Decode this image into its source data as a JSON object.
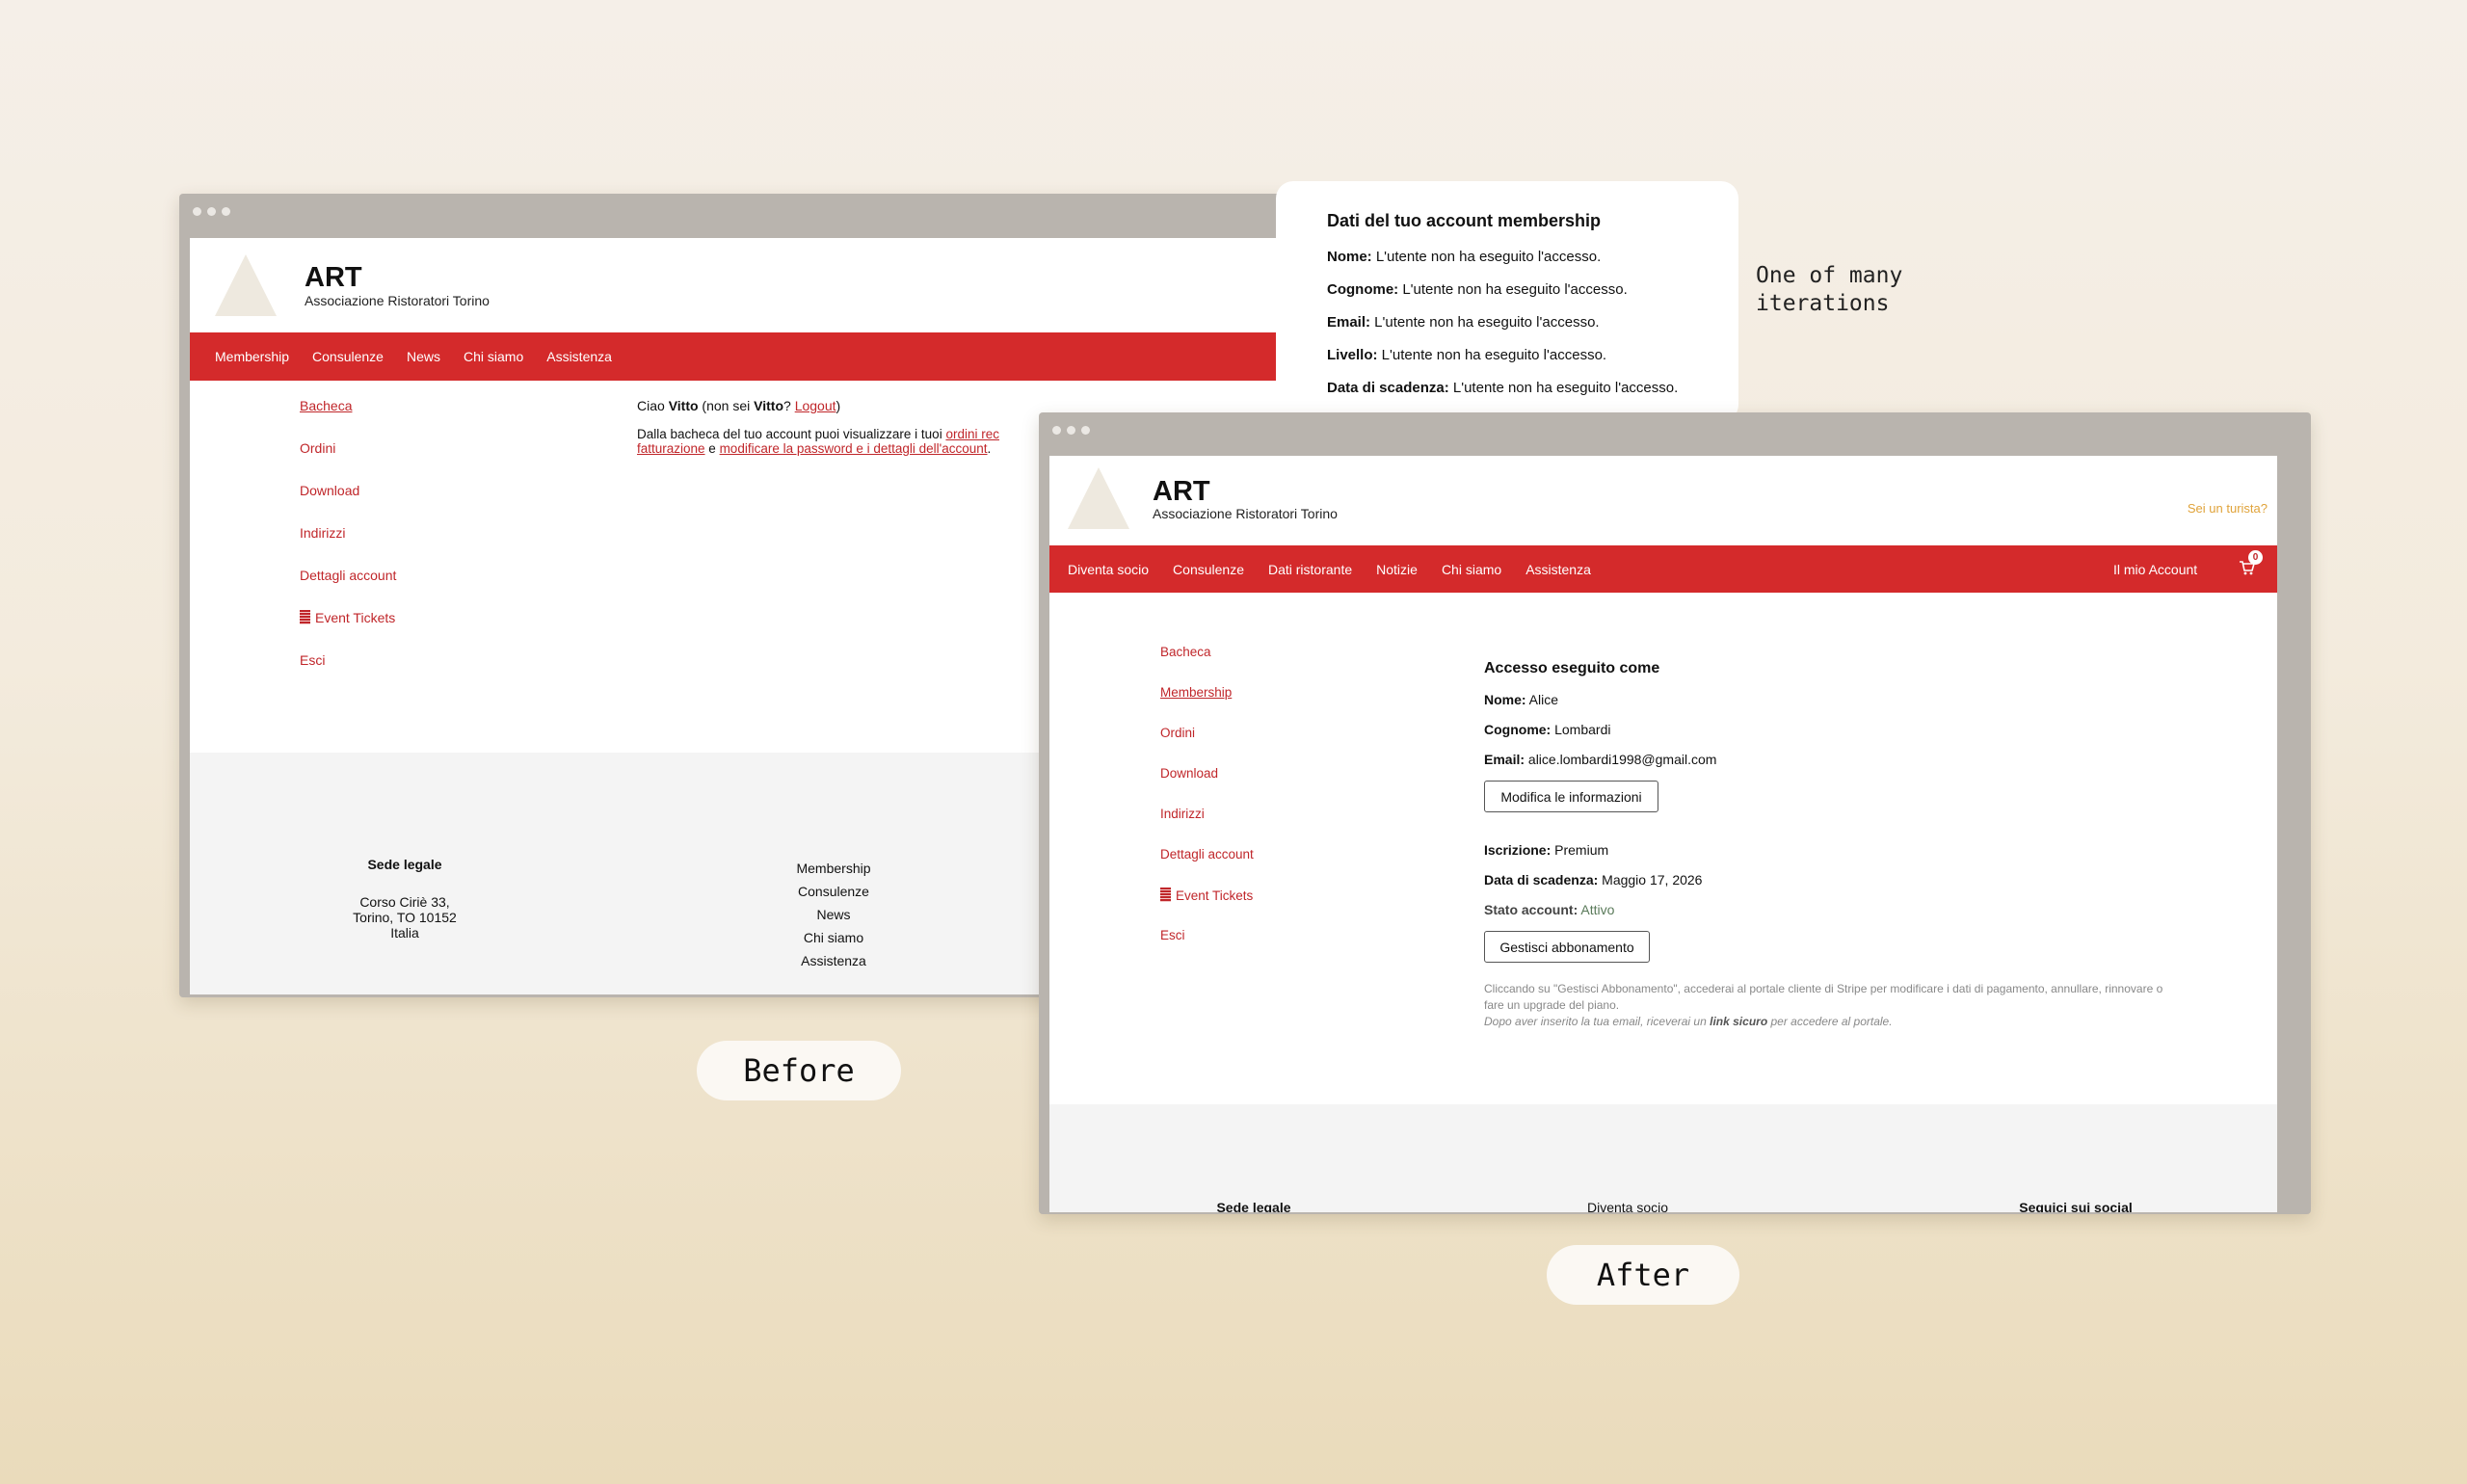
{
  "brand": {
    "title": "ART",
    "subtitle": "Associazione Ristoratori Torino"
  },
  "before": {
    "nav": [
      "Membership",
      "Consulenze",
      "News",
      "Chi siamo",
      "Assistenza"
    ],
    "sidebar": [
      "Bacheca",
      "Ordini",
      "Download",
      "Indirizzi",
      "Dettagli account",
      "Event Tickets",
      "Esci"
    ],
    "greeting": {
      "hello": "Ciao ",
      "name": "Vitto",
      "not_you": " (non sei ",
      "name2": "Vitto",
      "q": "? ",
      "logout": "Logout",
      "close": ")"
    },
    "dashboard_text": {
      "part1": "Dalla bacheca del tuo account puoi visualizzare i tuoi ",
      "link1": "ordini rec",
      "link2": "fatturazione",
      "part2": " e ",
      "link3": "modificare la password e i dettagli dell'account",
      "part3": "."
    },
    "footer": {
      "sede_title": "Sede legale",
      "address": [
        "Corso Ciriè 33,",
        "Torino, TO 10152",
        "Italia"
      ],
      "links": [
        "Membership",
        "Consulenze",
        "News",
        "Chi siamo",
        "Assistenza"
      ]
    },
    "label": "Before"
  },
  "popup": {
    "title": "Dati del tuo account membership",
    "rows": [
      {
        "k": "Nome:",
        "v": " L'utente non ha eseguito l'accesso."
      },
      {
        "k": "Cognome:",
        "v": " L'utente non ha eseguito l'accesso."
      },
      {
        "k": "Email:",
        "v": " L'utente non ha eseguito l'accesso."
      },
      {
        "k": "Livello:",
        "v": " L'utente non ha eseguito l'accesso."
      },
      {
        "k": "Data di scadenza:",
        "v": " L'utente non ha eseguito l'accesso."
      }
    ]
  },
  "iterations_note": "One of many\niterations",
  "after": {
    "tourist_link": "Sei un turista?",
    "nav": [
      "Diventa socio",
      "Consulenze",
      "Dati ristorante",
      "Notizie",
      "Chi siamo",
      "Assistenza"
    ],
    "account_link": "Il mio Account",
    "cart_count": "0",
    "sidebar": [
      "Bacheca",
      "Membership",
      "Ordini",
      "Download",
      "Indirizzi",
      "Dettagli account",
      "Event Tickets",
      "Esci"
    ],
    "heading": "Accesso eseguito come",
    "profile": [
      {
        "k": "Nome:",
        "v": " Alice"
      },
      {
        "k": "Cognome:",
        "v": " Lombardi"
      },
      {
        "k": "Email:",
        "v": " alice.lombardi1998@gmail.com"
      }
    ],
    "edit_button": "Modifica le informazioni",
    "subscription": [
      {
        "k": "Iscrizione:",
        "v": " Premium"
      },
      {
        "k": "Data di scadenza:",
        "v": " Maggio 17, 2026"
      }
    ],
    "status_label": "Stato account:",
    "status_value": " Attivo",
    "manage_button": "Gestisci abbonamento",
    "note_line1": "Cliccando su \"Gestisci Abbonamento\", accederai al portale cliente di Stripe per modificare i dati di pagamento, annullare, rinnovare o fare un upgrade del piano.",
    "note_line2_a": "Dopo aver inserito la tua email, riceverai un ",
    "note_line2_b": "link sicuro",
    "note_line2_c": " per accedere al portale.",
    "footer": {
      "sede_title": "Sede legale",
      "link_first": "Diventa socio",
      "social_title": "Seguici sui social"
    },
    "label": "After"
  },
  "colors": {
    "brand_red": "#d42a2b",
    "link_red": "#c0262a",
    "tourist": "#e0a33a",
    "status_green": "#5a7a5a"
  }
}
